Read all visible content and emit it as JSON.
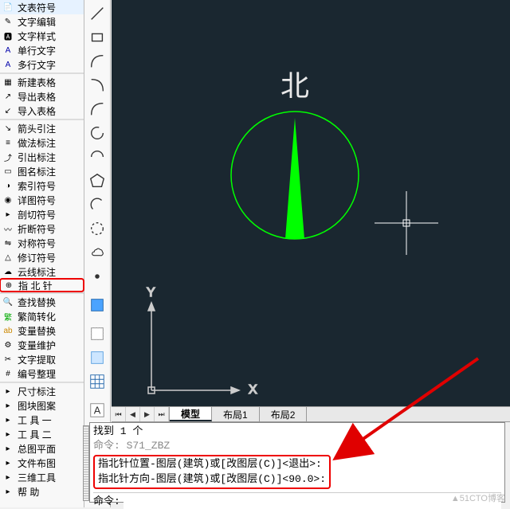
{
  "toolbar_left": {
    "group1": [
      {
        "label": "文表符号"
      },
      {
        "label": "文字编辑"
      },
      {
        "label": "文字样式"
      },
      {
        "label": "单行文字"
      },
      {
        "label": "多行文字"
      }
    ],
    "group2": [
      {
        "label": "新建表格"
      },
      {
        "label": "导出表格"
      },
      {
        "label": "导入表格"
      }
    ],
    "group3": [
      {
        "label": "箭头引注"
      },
      {
        "label": "做法标注"
      },
      {
        "label": "引出标注"
      },
      {
        "label": "图名标注"
      },
      {
        "label": "索引符号"
      },
      {
        "label": "详图符号"
      },
      {
        "label": "剖切符号"
      },
      {
        "label": "折断符号"
      },
      {
        "label": "对称符号"
      },
      {
        "label": "修订符号"
      },
      {
        "label": "云线标注"
      },
      {
        "label": "指 北 针",
        "highlight": true
      }
    ],
    "group4": [
      {
        "label": "查找替换"
      },
      {
        "label": "繁简转化"
      },
      {
        "label": "变量替换"
      },
      {
        "label": "变量维护"
      },
      {
        "label": "文字提取"
      },
      {
        "label": "编号整理"
      }
    ],
    "group5": [
      {
        "label": "尺寸标注",
        "arrow": true
      },
      {
        "label": "图块图案",
        "arrow": true
      },
      {
        "label": "工  具  一",
        "arrow": true
      },
      {
        "label": "工  具  二",
        "arrow": true
      },
      {
        "label": "总图平面",
        "arrow": true
      },
      {
        "label": "文件布图",
        "arrow": true
      },
      {
        "label": "三维工具",
        "arrow": true
      },
      {
        "label": "帮        助",
        "arrow": true
      }
    ]
  },
  "toolbar2_icons": [
    "line",
    "arc-br",
    "arc-tr",
    "arc-bl",
    "circle",
    "arc-full",
    "polygon",
    "arc-small",
    "circle2",
    "revcloud",
    "dot",
    "bluebox",
    "grid",
    "select",
    "text-a"
  ],
  "compass": {
    "label": "北"
  },
  "axes": {
    "x": "X",
    "y": "Y"
  },
  "tabs": {
    "model": "模型",
    "layout1": "布局1",
    "layout2": "布局2"
  },
  "command": {
    "found": "找到 1 个",
    "lastcmd": "命令: S71_ZBZ",
    "line1": "指北针位置-图层(建筑)或[改图层(C)]<退出>:",
    "line2": "指北针方向-图层(建筑)或[改图层(C)]<90.0>:",
    "prompt_label": "命令:",
    "input_value": ""
  },
  "watermark": "▲51CTO博客"
}
